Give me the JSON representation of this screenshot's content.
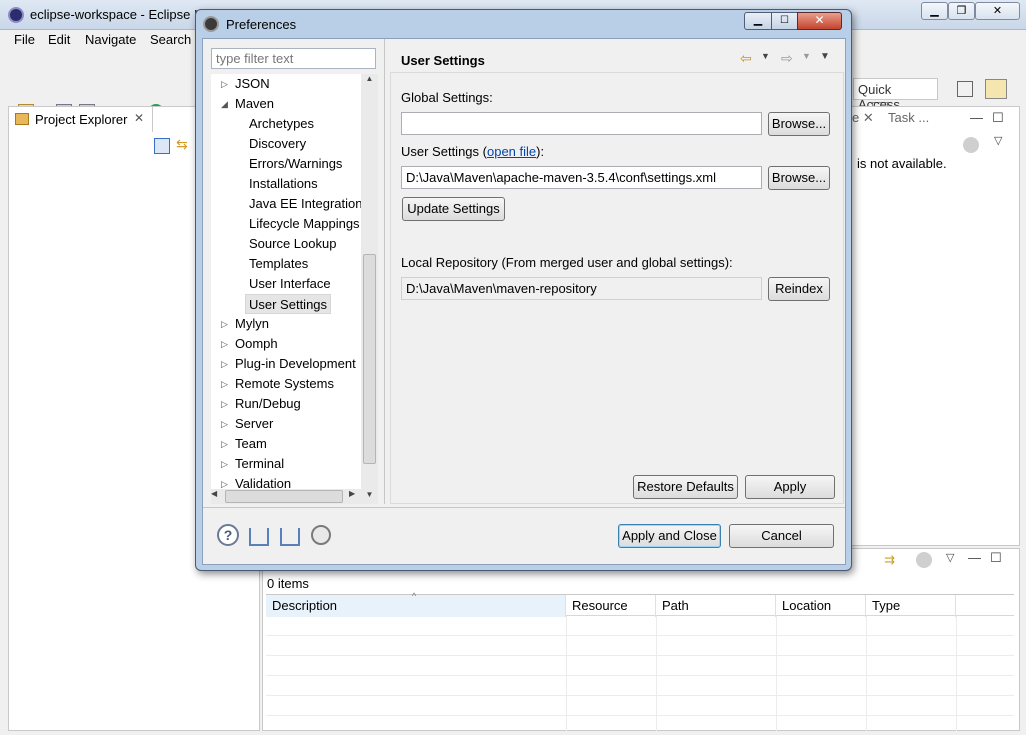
{
  "eclipse": {
    "window_title": "eclipse-workspace - Eclipse IDE",
    "menu": [
      "File",
      "Edit",
      "Navigate",
      "Search"
    ],
    "quick_access": "Quick Access",
    "project_explorer_tab": "Project Explorer",
    "task_tab": "Task ...",
    "not_available": "is not available.",
    "problems": {
      "items_count": "0 items",
      "columns": [
        "Description",
        "Resource",
        "Path",
        "Location",
        "Type"
      ]
    }
  },
  "dialog": {
    "title": "Preferences",
    "filter_placeholder": "type filter text",
    "tree": [
      {
        "label": "JSON",
        "level": 0,
        "expanded": false
      },
      {
        "label": "Maven",
        "level": 0,
        "expanded": true
      },
      {
        "label": "Archetypes",
        "level": 1
      },
      {
        "label": "Discovery",
        "level": 1
      },
      {
        "label": "Errors/Warnings",
        "level": 1
      },
      {
        "label": "Installations",
        "level": 1
      },
      {
        "label": "Java EE Integration",
        "level": 1
      },
      {
        "label": "Lifecycle Mappings",
        "level": 1
      },
      {
        "label": "Source Lookup",
        "level": 1
      },
      {
        "label": "Templates",
        "level": 1
      },
      {
        "label": "User Interface",
        "level": 1
      },
      {
        "label": "User Settings",
        "level": 1,
        "selected": true
      },
      {
        "label": "Mylyn",
        "level": 0,
        "expanded": false
      },
      {
        "label": "Oomph",
        "level": 0,
        "expanded": false
      },
      {
        "label": "Plug-in Development",
        "level": 0,
        "expanded": false
      },
      {
        "label": "Remote Systems",
        "level": 0,
        "expanded": false
      },
      {
        "label": "Run/Debug",
        "level": 0,
        "expanded": false
      },
      {
        "label": "Server",
        "level": 0,
        "expanded": false
      },
      {
        "label": "Team",
        "level": 0,
        "expanded": false
      },
      {
        "label": "Terminal",
        "level": 0,
        "expanded": false
      },
      {
        "label": "Validation",
        "level": 0,
        "expanded": false
      }
    ],
    "page": {
      "title": "User Settings",
      "global_settings_label": "Global Settings:",
      "global_settings_value": "",
      "user_settings_label": "User Settings (",
      "user_settings_link": "open file",
      "user_settings_suffix": "):",
      "user_settings_value": "D:\\Java\\Maven\\apache-maven-3.5.4\\conf\\settings.xml",
      "browse_label": "Browse...",
      "update_settings_label": "Update Settings",
      "local_repo_label": "Local Repository (From merged user and global settings):",
      "local_repo_value": "D:\\Java\\Maven\\maven-repository",
      "reindex_label": "Reindex",
      "restore_defaults_label": "Restore Defaults",
      "apply_label": "Apply"
    },
    "apply_close_label": "Apply and Close",
    "cancel_label": "Cancel"
  }
}
